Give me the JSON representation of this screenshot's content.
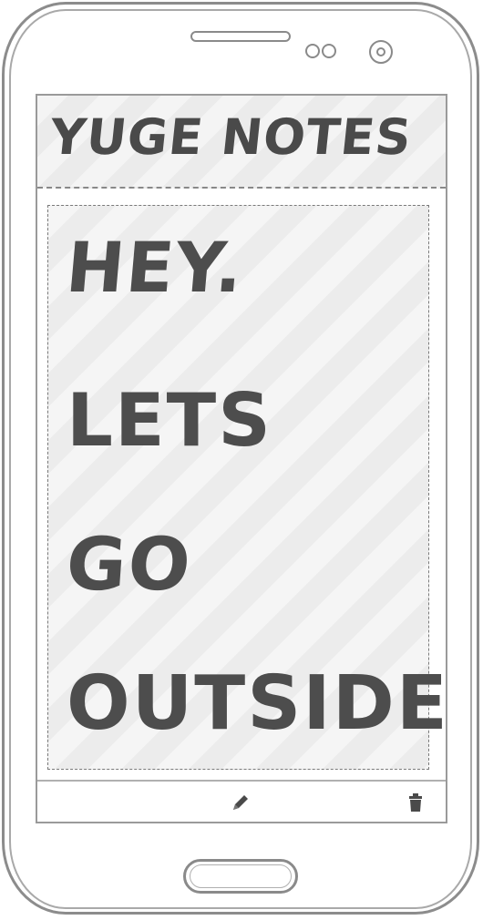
{
  "app": {
    "title": "YUGE NOTES"
  },
  "note": {
    "lines": [
      "HEY.",
      "LETS",
      "GO",
      "OUTSIDE"
    ]
  },
  "toolbar": {
    "edit_icon": "pencil-icon",
    "delete_icon": "trash-icon"
  },
  "colors": {
    "ink": "#4a4a4a",
    "frame": "#8c8c8c"
  }
}
